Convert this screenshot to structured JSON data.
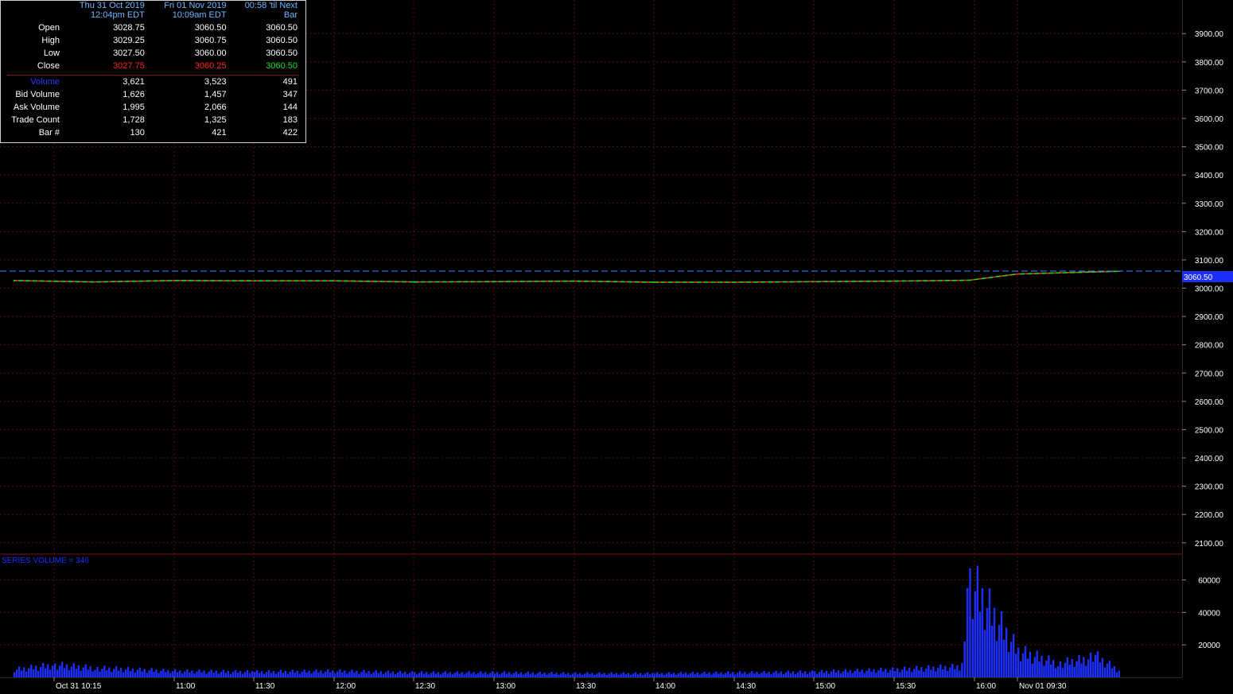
{
  "data_window": {
    "columns": [
      {
        "date": "Thu 31 Oct 2019",
        "time": "12:04pm EDT"
      },
      {
        "date": "Fri 01 Nov 2019",
        "time": "10:09am EDT"
      },
      {
        "date": "00:58 'til Next",
        "time": "Bar"
      }
    ],
    "rows": [
      {
        "label": "Open",
        "values": [
          "3028.75",
          "3060.50",
          "3060.50"
        ]
      },
      {
        "label": "High",
        "values": [
          "3029.25",
          "3060.75",
          "3060.50"
        ]
      },
      {
        "label": "Low",
        "values": [
          "3027.50",
          "3060.00",
          "3060.50"
        ]
      },
      {
        "label": "Close",
        "values": [
          "3027.75",
          "3060.25",
          "3060.50"
        ],
        "colors": [
          "#ff2222",
          "#ff2222",
          "#22dd22"
        ]
      }
    ],
    "volume_rows": [
      {
        "label": "Volume",
        "values": [
          "3,621",
          "3,523",
          "491"
        ],
        "label_color": "#2a3cff"
      },
      {
        "label": "Bid Volume",
        "values": [
          "1,626",
          "1,457",
          "347"
        ]
      },
      {
        "label": "Ask Volume",
        "values": [
          "1,995",
          "2,066",
          "144"
        ]
      },
      {
        "label": "Trade Count",
        "values": [
          "1,728",
          "1,325",
          "183"
        ]
      },
      {
        "label": "Bar #",
        "values": [
          "130",
          "421",
          "422"
        ]
      }
    ]
  },
  "chart_data": [
    {
      "type": "line",
      "title": "",
      "price_axis_ticks": [
        "3900.00",
        "3800.00",
        "3700.00",
        "3600.00",
        "3500.00",
        "3400.00",
        "3300.00",
        "3200.00",
        "3100.00",
        "3000.00",
        "2900.00",
        "2800.00",
        "2700.00",
        "2600.00",
        "2500.00",
        "2400.00",
        "2300.00",
        "2200.00",
        "2100.00"
      ],
      "ylim": [
        2060,
        3985
      ],
      "last_price_label": "3060.50",
      "last_price": 3060.5,
      "x_ticks": [
        "Oct 31 10:15",
        "11:00",
        "11:30",
        "12:00",
        "12:30",
        "13:00",
        "13:30",
        "14:00",
        "14:30",
        "15:00",
        "15:30",
        "16:00",
        "Nov 01 09:30"
      ],
      "series": [
        {
          "x": [
            "Oct 31 10:00",
            "Oct 31 10:30",
            "Oct 31 11:00",
            "Oct 31 11:30",
            "Oct 31 12:00",
            "Oct 31 12:30",
            "Oct 31 13:00",
            "Oct 31 13:30",
            "Oct 31 14:00",
            "Oct 31 14:30",
            "Oct 31 15:00",
            "Oct 31 15:30",
            "Oct 31 15:58",
            "Nov 01 09:30",
            "Nov 01 10:09"
          ],
          "values": [
            3027,
            3022,
            3027,
            3026,
            3026,
            3022,
            3023,
            3025,
            3021,
            3021,
            3023,
            3025,
            3028,
            3050,
            3060
          ]
        }
      ],
      "colors": {
        "up": "#22dd22",
        "down": "#ff2222",
        "last_price_line": "#3b8cff"
      }
    },
    {
      "type": "bar",
      "title": "SERIES VOLUME = 346",
      "y_ticks": [
        "60000",
        "40000",
        "20000"
      ],
      "ylim": [
        0,
        73000
      ],
      "series": [
        {
          "x": [
            "Oct 31 10:00",
            "Oct 31 10:15",
            "Oct 31 10:30",
            "Oct 31 11:00",
            "Oct 31 11:30",
            "Oct 31 12:00",
            "Oct 31 12:30",
            "Oct 31 13:00",
            "Oct 31 13:30",
            "Oct 31 14:00",
            "Oct 31 14:30",
            "Oct 31 15:00",
            "Oct 31 15:30",
            "Oct 31 15:55",
            "Oct 31 15:58",
            "Oct 31 15:59",
            "Nov 01 09:30",
            "Nov 01 09:45",
            "Nov 01 10:00",
            "Nov 01 10:09"
          ],
          "values": [
            5000,
            8000,
            6000,
            4000,
            3500,
            4000,
            3000,
            3000,
            2500,
            2500,
            3000,
            3500,
            5000,
            7000,
            73000,
            60000,
            17000,
            9000,
            13000,
            3500
          ]
        }
      ],
      "colors": {
        "bars": "#1c2fff"
      }
    }
  ]
}
